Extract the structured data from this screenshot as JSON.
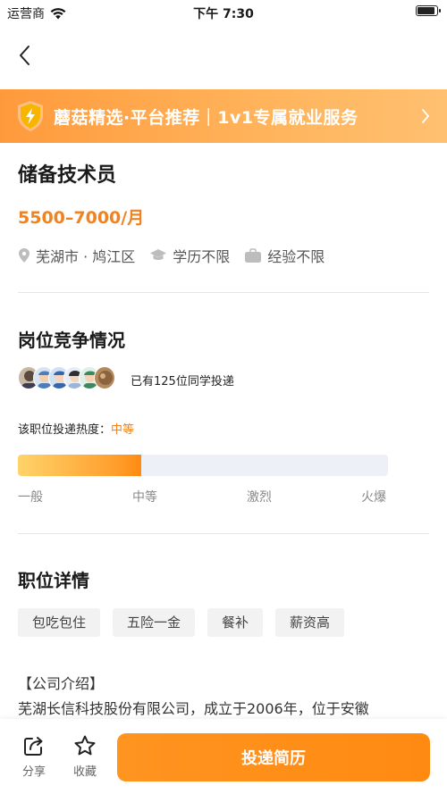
{
  "status_bar": {
    "carrier": "运营商",
    "time": "下午 7:30"
  },
  "banner": {
    "text": "蘑菇精选·平台推荐｜1v1专属就业服务"
  },
  "job": {
    "title": "储备技术员",
    "salary": "5500–7000/月",
    "location": "芜湖市 · 鸠江区",
    "education": "学历不限",
    "experience": "经验不限"
  },
  "competition": {
    "title": "岗位竞争情况",
    "applied_text": "已有125位同学投递",
    "heat_label": "该职位投递热度：",
    "heat_level": "中等",
    "heat_progress": 0.333,
    "scale": [
      "一般",
      "中等",
      "激烈",
      "火爆"
    ]
  },
  "details": {
    "title": "职位详情",
    "tags": [
      "包吃包住",
      "五险一金",
      "餐补",
      "薪资高"
    ],
    "intro_head": "【公司介绍】",
    "intro_body": "芜湖长信科技股份有限公司，成立于2006年，位于安徽"
  },
  "bottom": {
    "share": "分享",
    "favorite": "收藏",
    "apply": "投递简历"
  },
  "colors": {
    "accent": "#f08321",
    "banner_start": "#ff9a3c",
    "banner_end": "#ffc070"
  }
}
